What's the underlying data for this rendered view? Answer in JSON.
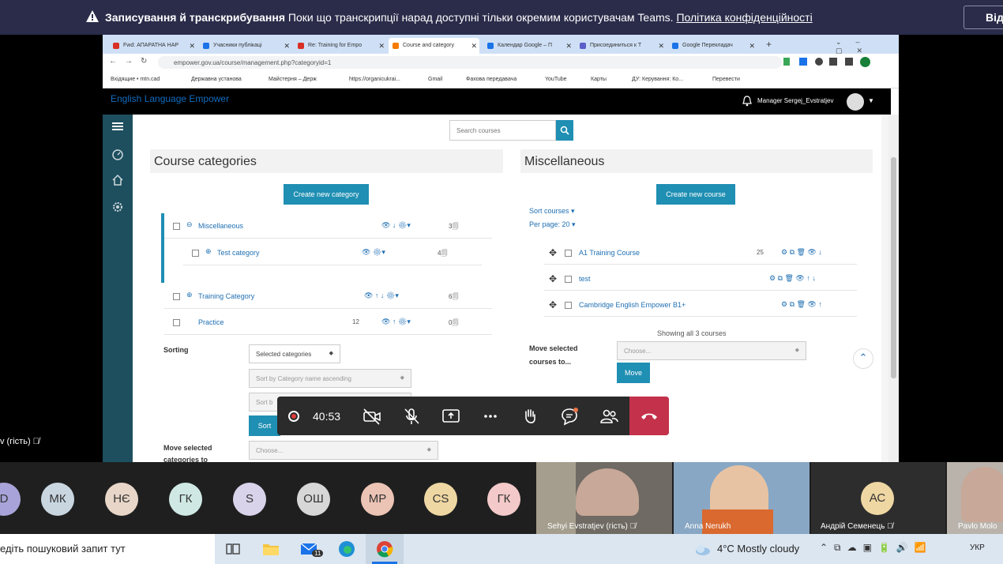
{
  "teams_banner": {
    "title": "Записування й транскрибування",
    "message": "Поки що транскрипції нарад доступні тільки окремим користувачам Teams.",
    "link": "Політика конфіденційності",
    "button": "Від"
  },
  "browser": {
    "tabs": [
      {
        "label": "Fwd: АПАРАТНА НАР",
        "color": "#d93025"
      },
      {
        "label": "Учасники публікаці",
        "color": "#1a73e8"
      },
      {
        "label": "Re: Training for Empo",
        "color": "#d93025"
      },
      {
        "label": "Course and category",
        "color": "#f57c00"
      },
      {
        "label": "Календар Google – П",
        "color": "#1a73e8"
      },
      {
        "label": "Присоединиться к Т",
        "color": "#5b5fc7"
      },
      {
        "label": "Google Перекладач",
        "color": "#1a73e8"
      }
    ],
    "url": "empower.gov.ua/course/management.php?categoryid=1",
    "bookmarks": [
      "Вхідящие • mtn.cad",
      "Державна установа",
      "Майстерня – Держ",
      "https://organicukrai...",
      "Gmail",
      "Фахова передавача",
      "YouTube",
      "Карты",
      "ДУ: Керування: Ко...",
      "Перевести"
    ]
  },
  "site": {
    "brand": "English Language Empower",
    "user": "Manager Sergej_Evstratjev",
    "search_placeholder": "Search courses"
  },
  "categories_panel": {
    "title": "Course categories",
    "create_button": "Create new category",
    "rows": [
      {
        "name": "Miscellaneous",
        "count": "3"
      },
      {
        "name": "Test category",
        "count": "4"
      },
      {
        "name": "Training Category",
        "count": "6"
      },
      {
        "name": "Practice",
        "count": "0",
        "extra": "12"
      }
    ],
    "sorting_label": "Sorting",
    "sorting_select": "Selected categories",
    "sort_by": "Sort by Category name ascending",
    "sort_by2": "Sort b",
    "sort_button": "Sort",
    "move_label": "Move selected categories to",
    "move_select": "Choose..."
  },
  "courses_panel": {
    "title": "Miscellaneous",
    "create_button": "Create new course",
    "sort_courses": "Sort courses",
    "per_page": "Per page: 20",
    "courses": [
      {
        "name": "A1 Training Course",
        "count": "25"
      },
      {
        "name": "test",
        "count": ""
      },
      {
        "name": "Cambridge English Empower B1+",
        "count": ""
      }
    ],
    "showing": "Showing all 3 courses",
    "move_label": "Move selected courses to...",
    "move_select": "Choose...",
    "move_button": "Move"
  },
  "meeting": {
    "timer": "40:53"
  },
  "participants": {
    "guest_label": "v (гість)",
    "avatars": [
      {
        "initials": "D",
        "color": "#a8a4d9"
      },
      {
        "initials": "МК",
        "color": "#c9d6e0"
      },
      {
        "initials": "НЄ",
        "color": "#e8d6c8"
      },
      {
        "initials": "ГК",
        "color": "#cfe8e3"
      },
      {
        "initials": "S",
        "color": "#d8d3ea"
      },
      {
        "initials": "ОШ",
        "color": "#d7d7d7"
      },
      {
        "initials": "МР",
        "color": "#ecc4b5"
      },
      {
        "initials": "CS",
        "color": "#efd7a3"
      },
      {
        "initials": "ГК",
        "color": "#f3c9c9"
      }
    ],
    "videos": [
      {
        "name": "Sehyi Evstratjev (гість)"
      },
      {
        "name": "Anna Nerukh"
      },
      {
        "name": "Андрій Семенець",
        "initials": "АС"
      },
      {
        "name": "Pavlo Molo"
      }
    ]
  },
  "taskbar": {
    "search": "едіть пошуковий запит тут",
    "weather": "4°C  Mostly cloudy",
    "lang": "УКР",
    "mail_badge": "11"
  }
}
